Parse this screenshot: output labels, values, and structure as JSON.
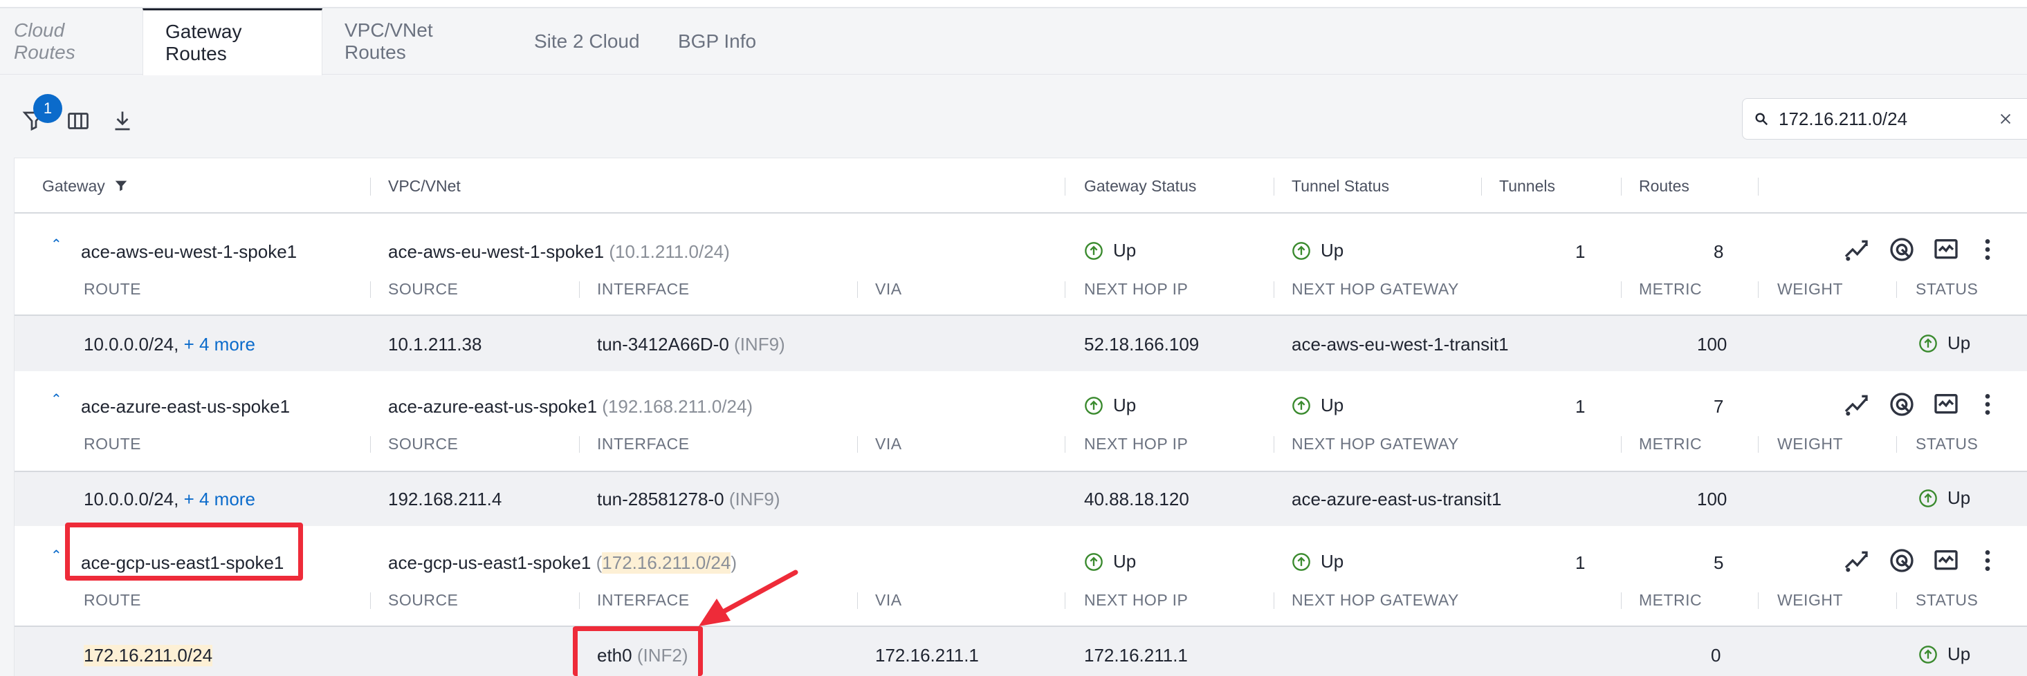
{
  "tabs": [
    {
      "label": "Cloud Routes",
      "active": false
    },
    {
      "label": "Gateway Routes",
      "active": true
    },
    {
      "label": "VPC/VNet Routes",
      "active": false
    },
    {
      "label": "Site 2 Cloud",
      "active": false
    },
    {
      "label": "BGP Info",
      "active": false
    }
  ],
  "toolbar": {
    "filter_count": "1",
    "icons": [
      "filter-icon",
      "columns-icon",
      "download-icon"
    ]
  },
  "search": {
    "value": "172.16.211.0/24",
    "icon": "search-icon",
    "clear_icon": "close-icon"
  },
  "table": {
    "headers": {
      "gateway": "Gateway",
      "vpc": "VPC/VNet",
      "gateway_status": "Gateway Status",
      "tunnel_status": "Tunnel Status",
      "tunnels": "Tunnels",
      "routes": "Routes"
    },
    "route_headers": {
      "route": "ROUTE",
      "source": "SOURCE",
      "interface": "INTERFACE",
      "via": "VIA",
      "next_hop_ip": "NEXT HOP IP",
      "next_hop_gateway": "NEXT HOP GATEWAY",
      "metric": "METRIC",
      "weight": "WEIGHT",
      "status": "STATUS"
    },
    "gateways": [
      {
        "name": "ace-aws-eu-west-1-spoke1",
        "vpc": "ace-aws-eu-west-1-spoke1",
        "vpc_cidr": "(10.1.211.0/24)",
        "gateway_status": "Up",
        "tunnel_status": "Up",
        "tunnels": "1",
        "routes": "8",
        "route": {
          "route": "10.0.0.0/24,",
          "more": "+ 4 more",
          "source": "10.1.211.38",
          "interface": "tun-3412A66D-0",
          "interface_tag": "(INF9)",
          "via": "",
          "next_hop_ip": "52.18.166.109",
          "next_hop_gateway": "ace-aws-eu-west-1-transit1",
          "metric": "100",
          "weight": "",
          "status": "Up"
        }
      },
      {
        "name": "ace-azure-east-us-spoke1",
        "vpc": "ace-azure-east-us-spoke1",
        "vpc_cidr": "(192.168.211.0/24)",
        "gateway_status": "Up",
        "tunnel_status": "Up",
        "tunnels": "1",
        "routes": "7",
        "route": {
          "route": "10.0.0.0/24,",
          "more": "+ 4 more",
          "source": "192.168.211.4",
          "interface": "tun-28581278-0",
          "interface_tag": "(INF9)",
          "via": "",
          "next_hop_ip": "40.88.18.120",
          "next_hop_gateway": "ace-azure-east-us-transit1",
          "metric": "100",
          "weight": "",
          "status": "Up"
        }
      },
      {
        "name": "ace-gcp-us-east1-spoke1",
        "vpc": "ace-gcp-us-east1-spoke1",
        "vpc_cidr_open": "(",
        "vpc_cidr": "172.16.211.0/24",
        "vpc_cidr_close": ")",
        "gateway_status": "Up",
        "tunnel_status": "Up",
        "tunnels": "1",
        "routes": "5",
        "route": {
          "route": "172.16.211.0/24",
          "source": "",
          "interface": "eth0",
          "interface_tag": "(INF2)",
          "via": "172.16.211.1",
          "next_hop_ip": "172.16.211.1",
          "next_hop_gateway": "",
          "metric": "0",
          "weight": "",
          "status": "Up"
        }
      }
    ]
  },
  "colors": {
    "accent": "#0b6bcb",
    "status_up": "#3a8a2e",
    "highlight": "#fdf0d5",
    "annotation": "#ee2b39"
  }
}
